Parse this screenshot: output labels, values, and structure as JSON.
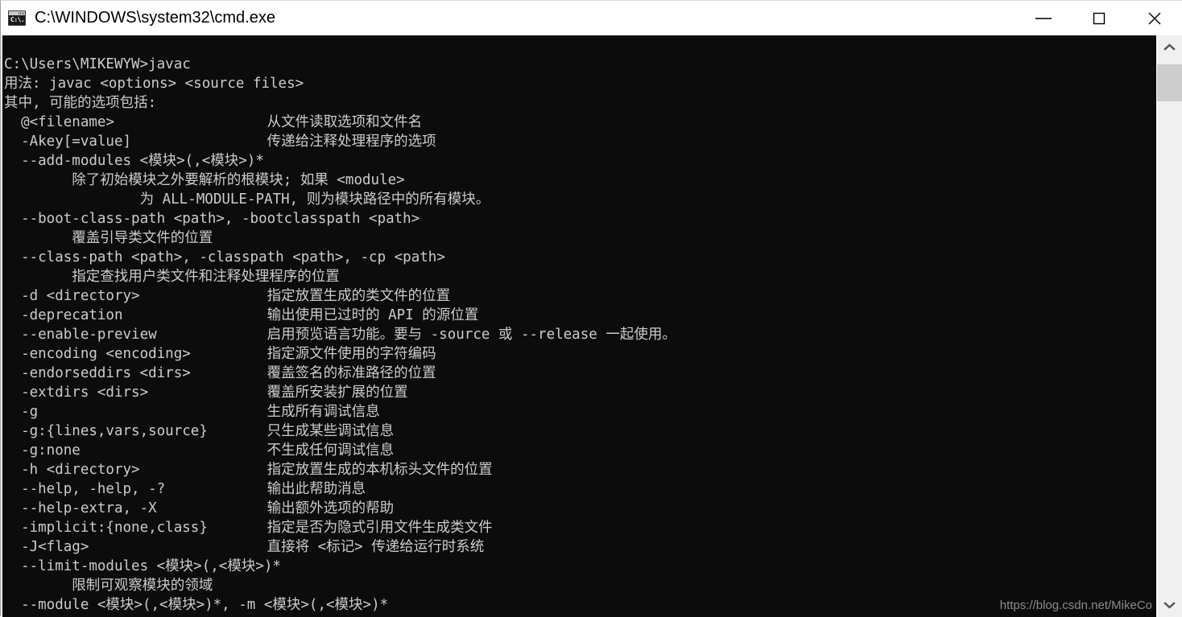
{
  "window": {
    "title": "C:\\WINDOWS\\system32\\cmd.exe",
    "icon": "cmd-prompt-icon",
    "icon_glyph": "C:\\.",
    "controls": {
      "minimize": "minimize-icon",
      "maximize": "maximize-icon",
      "close": "close-icon"
    },
    "background": "#0c0c0c",
    "foreground": "#cccccc",
    "titlebar_background": "#ffffff"
  },
  "scrollbar": {
    "up_arrow": "chevron-up-icon",
    "down_arrow": "chevron-down-icon",
    "thumb": "scrollbar-thumb"
  },
  "watermark": "https://blog.csdn.net/MikeCo",
  "terminal": {
    "lines": [
      "C:\\Users\\MIKEWYW>javac",
      "用法: javac <options> <source files>",
      "其中, 可能的选项包括:",
      "  @<filename>                  从文件读取选项和文件名",
      "  -Akey[=value]                传递给注释处理程序的选项",
      "  --add-modules <模块>(,<模块>)*",
      "        除了初始模块之外要解析的根模块; 如果 <module>",
      "                为 ALL-MODULE-PATH, 则为模块路径中的所有模块。",
      "  --boot-class-path <path>, -bootclasspath <path>",
      "        覆盖引导类文件的位置",
      "  --class-path <path>, -classpath <path>, -cp <path>",
      "        指定查找用户类文件和注释处理程序的位置",
      "  -d <directory>               指定放置生成的类文件的位置",
      "  -deprecation                 输出使用已过时的 API 的源位置",
      "  --enable-preview             启用预览语言功能。要与 -source 或 --release 一起使用。",
      "  -encoding <encoding>         指定源文件使用的字符编码",
      "  -endorseddirs <dirs>         覆盖签名的标准路径的位置",
      "  -extdirs <dirs>              覆盖所安装扩展的位置",
      "  -g                           生成所有调试信息",
      "  -g:{lines,vars,source}       只生成某些调试信息",
      "  -g:none                      不生成任何调试信息",
      "  -h <directory>               指定放置生成的本机标头文件的位置",
      "  --help, -help, -?            输出此帮助消息",
      "  --help-extra, -X             输出额外选项的帮助",
      "  -implicit:{none,class}       指定是否为隐式引用文件生成类文件",
      "  -J<flag>                     直接将 <标记> 传递给运行时系统",
      "  --limit-modules <模块>(,<模块>)*",
      "        限制可观察模块的领域",
      "  --module <模块>(,<模块>)*, -m <模块>(,<模块>)*"
    ]
  }
}
